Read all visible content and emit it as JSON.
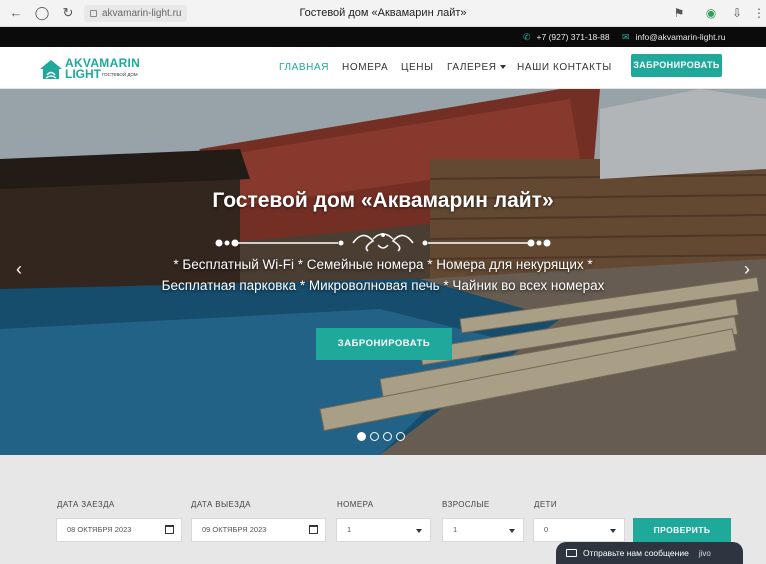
{
  "browser": {
    "url": "akvamarin-light.ru",
    "tab_title": "Гостевой дом «Аквамарин лайт»"
  },
  "topbar": {
    "phone": "+7 (927) 371-18-88",
    "email": "info@akvamarin-light.ru"
  },
  "logo": {
    "line1": "AKVAMARIN",
    "line2": "LIGHT",
    "tagline": "ГОСТЕВОЙ ДОМ"
  },
  "nav": {
    "items": [
      {
        "label": "ГЛАВНАЯ",
        "active": true
      },
      {
        "label": "НОМЕРА",
        "active": false
      },
      {
        "label": "ЦЕНЫ",
        "active": false
      },
      {
        "label": "ГАЛЕРЕЯ",
        "active": false,
        "dropdown": true
      },
      {
        "label": "НАШИ КОНТАКТЫ",
        "active": false
      }
    ],
    "book_button": "ЗАБРОНИРОВАТЬ"
  },
  "hero": {
    "title": "Гостевой дом «Аквамарин лайт»",
    "description": "* Бесплатный Wi-Fi * Семейные номера * Номера для некурящих * Бесплатная парковка * Микроволновая печь * Чайник во всех номерах",
    "cta": "ЗАБРОНИРОВАТЬ",
    "slides_total": 4,
    "active_slide": 1
  },
  "booking": {
    "checkin_label": "ДАТА ЗАЕЗДА",
    "checkin_value": "08 ОКТЯБРЯ 2023",
    "checkout_label": "ДАТА ВЫЕЗДА",
    "checkout_value": "09 ОКТЯБРЯ 2023",
    "rooms_label": "НОМЕРА",
    "rooms_value": "1",
    "adults_label": "ВЗРОСЛЫЕ",
    "adults_value": "1",
    "children_label": "ДЕТИ",
    "children_value": "0",
    "check_button": "ПРОВЕРИТЬ"
  },
  "chat": {
    "label": "Отправьте нам сообщение",
    "brand": "jivo"
  },
  "colors": {
    "accent": "#1ea99a",
    "topbar": "#0b0b0b",
    "booking_bg": "#e7e7e7"
  }
}
